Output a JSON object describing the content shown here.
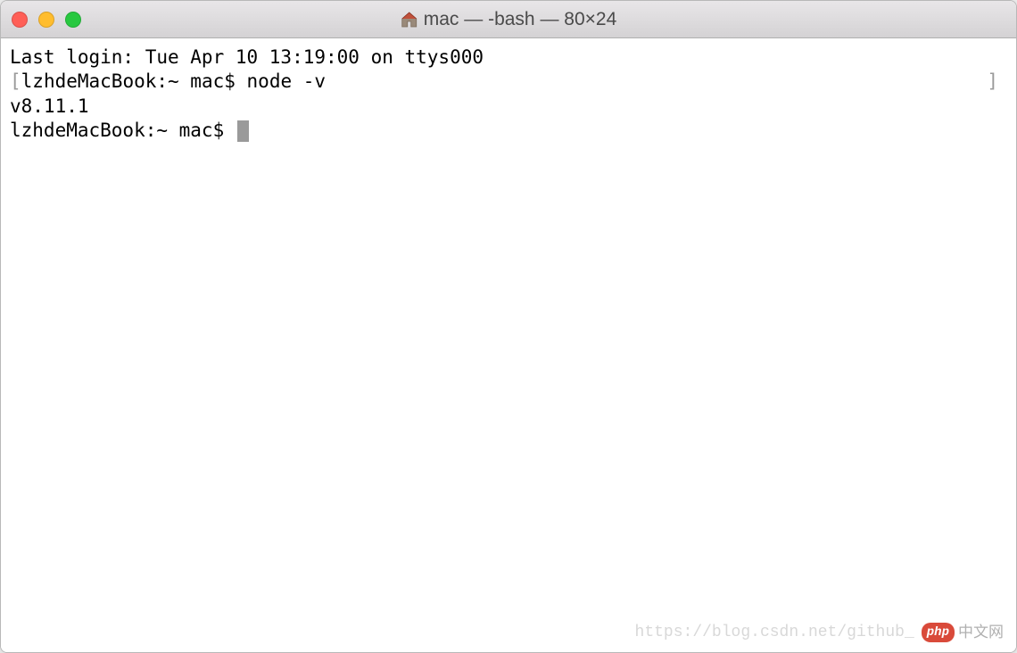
{
  "window": {
    "title": "mac — -bash — 80×24"
  },
  "terminal": {
    "lines": [
      {
        "type": "output",
        "text": "Last login: Tue Apr 10 13:19:00 on ttys000"
      },
      {
        "type": "prompt_cmd",
        "bracket_open": "[",
        "prompt": "lzhdeMacBook:~ mac$ ",
        "command": "node -v",
        "bracket_close": "]"
      },
      {
        "type": "output",
        "text": "v8.11.1"
      },
      {
        "type": "prompt",
        "prompt": "lzhdeMacBook:~ mac$ ",
        "cursor": true
      }
    ]
  },
  "watermark": {
    "url": "https://blog.csdn.net/github_",
    "badge_text": "php",
    "cn_text": "中文网"
  }
}
